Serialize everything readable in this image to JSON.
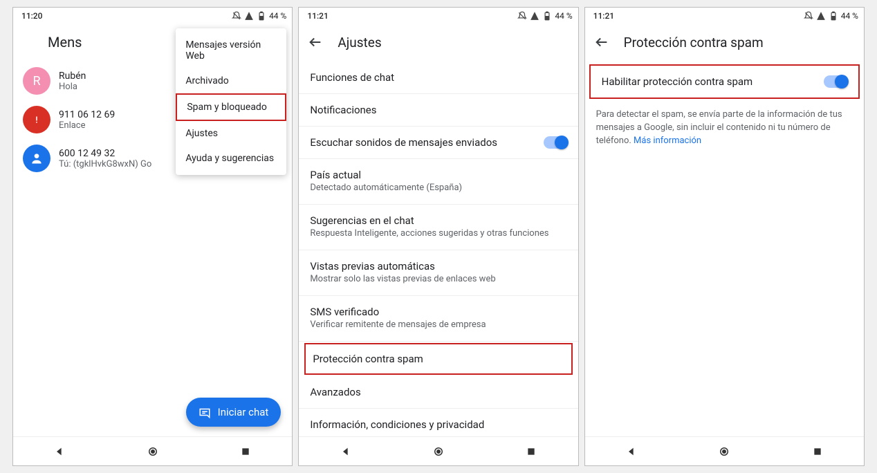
{
  "screens": {
    "s1": {
      "time": "11:20",
      "battery": "44 %",
      "title": "Mens",
      "menu": [
        "Mensajes versión Web",
        "Archivado",
        "Spam y bloqueado",
        "Ajustes",
        "Ayuda y sugerencias"
      ],
      "conversations": [
        {
          "name": "Rubén",
          "sub": "Hola",
          "avatar": "R",
          "kind": "letter"
        },
        {
          "name": "911 06 12 69",
          "sub": "Enlace",
          "kind": "alert"
        },
        {
          "name": "600 12 49 32",
          "sub": "Tú: (tgklHvkG8wxN) Go",
          "kind": "person"
        }
      ],
      "fab": "Iniciar chat"
    },
    "s2": {
      "time": "11:21",
      "battery": "44 %",
      "title": "Ajustes",
      "items": [
        {
          "title": "Funciones de chat"
        },
        {
          "title": "Notificaciones"
        },
        {
          "title": "Escuchar sonidos de mensajes enviados",
          "toggle": true
        },
        {
          "title": "País actual",
          "sub": "Detectado automáticamente (España)"
        },
        {
          "title": "Sugerencias en el chat",
          "sub": "Respuesta Inteligente, acciones sugeridas y otras funciones"
        },
        {
          "title": "Vistas previas automáticas",
          "sub": "Mostrar solo las vistas previas de enlaces web"
        },
        {
          "title": "SMS verificado",
          "sub": "Verificar remitente de mensajes de empresa"
        },
        {
          "title": "Protección contra spam",
          "highlight": true
        },
        {
          "title": "Avanzados"
        },
        {
          "title": "Información, condiciones y privacidad"
        }
      ]
    },
    "s3": {
      "time": "11:21",
      "battery": "44 %",
      "title": "Protección contra spam",
      "toggle_label": "Habilitar protección contra spam",
      "info": "Para detectar el spam, se envía parte de la información de tus mensajes a Google, sin incluir el contenido ni tu número de teléfono. ",
      "info_link": "Más información"
    }
  }
}
